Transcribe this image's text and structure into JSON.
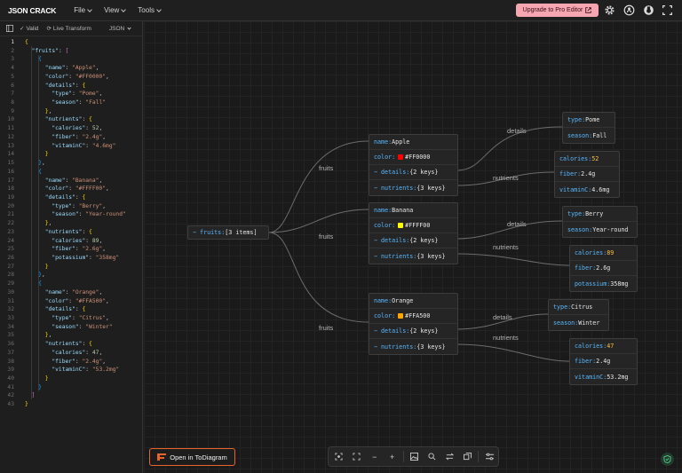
{
  "app": {
    "brand": "JSON CRACK",
    "menu": [
      "File",
      "View",
      "Tools"
    ],
    "upgrade_label": "Upgrade to Pro Editor",
    "icons": [
      "gear-icon",
      "github-icon",
      "discord-icon",
      "fullscreen-icon"
    ]
  },
  "editor": {
    "valid_label": "Valid",
    "transform_label": "Live Transform",
    "format_label": "JSON",
    "line_count": 43,
    "lines": [
      "{",
      "  \"fruits\": [",
      "    {",
      "      \"name\": \"Apple\",",
      "      \"color\": \"#FF0000\",",
      "      \"details\": {",
      "        \"type\": \"Pome\",",
      "        \"season\": \"Fall\"",
      "      },",
      "      \"nutrients\": {",
      "        \"calories\": 52,",
      "        \"fiber\": \"2.4g\",",
      "        \"vitaminC\": \"4.6mg\"",
      "      }",
      "    },",
      "    {",
      "      \"name\": \"Banana\",",
      "      \"color\": \"#FFFF00\",",
      "      \"details\": {",
      "        \"type\": \"Berry\",",
      "        \"season\": \"Year-round\"",
      "      },",
      "      \"nutrients\": {",
      "        \"calories\": 89,",
      "        \"fiber\": \"2.6g\",",
      "        \"potassium\": \"358mg\"",
      "      }",
      "    },",
      "    {",
      "      \"name\": \"Orange\",",
      "      \"color\": \"#FFA500\",",
      "      \"details\": {",
      "        \"type\": \"Citrus\",",
      "        \"season\": \"Winter\"",
      "      },",
      "      \"nutrients\": {",
      "        \"calories\": 47,",
      "        \"fiber\": \"2.4g\",",
      "        \"vitaminC\": \"53.2mg\"",
      "      }",
      "    }",
      "  ]",
      "}"
    ]
  },
  "graph": {
    "root": {
      "key": "fruits",
      "value": "[3 items]"
    },
    "edge_labels": {
      "fruits": "fruits",
      "details": "details",
      "nutrients": "nutrients"
    },
    "fruits": [
      {
        "name": "Apple",
        "color": "#FF0000",
        "details_summary": "{2 keys}",
        "nutrients_summary": "{3 keys}",
        "details": [
          {
            "k": "type",
            "v": "Pome"
          },
          {
            "k": "season",
            "v": "Fall"
          }
        ],
        "nutrients": [
          {
            "k": "calories",
            "v": "52",
            "num": true
          },
          {
            "k": "fiber",
            "v": "2.4g"
          },
          {
            "k": "vitaminC",
            "v": "4.6mg"
          }
        ]
      },
      {
        "name": "Banana",
        "color": "#FFFF00",
        "details_summary": "{2 keys}",
        "nutrients_summary": "{3 keys}",
        "details": [
          {
            "k": "type",
            "v": "Berry"
          },
          {
            "k": "season",
            "v": "Year-round"
          }
        ],
        "nutrients": [
          {
            "k": "calories",
            "v": "89",
            "num": true
          },
          {
            "k": "fiber",
            "v": "2.6g"
          },
          {
            "k": "potassium",
            "v": "358mg"
          }
        ]
      },
      {
        "name": "Orange",
        "color": "#FFA500",
        "details_summary": "{2 keys}",
        "nutrients_summary": "{3 keys}",
        "details": [
          {
            "k": "type",
            "v": "Citrus"
          },
          {
            "k": "season",
            "v": "Winter"
          }
        ],
        "nutrients": [
          {
            "k": "calories",
            "v": "47",
            "num": true
          },
          {
            "k": "fiber",
            "v": "2.4g"
          },
          {
            "k": "vitaminC",
            "v": "53.2mg"
          }
        ]
      }
    ]
  },
  "labels": {
    "name": "name",
    "color": "color",
    "details": "details",
    "nutrients": "nutrients"
  },
  "footer": {
    "todiagram_label": "Open in ToDiagram",
    "toolbar_icons": [
      "focus-icon",
      "fit-screen-icon",
      "zoom-out-icon",
      "zoom-in-icon",
      "image-export-icon",
      "search-icon",
      "swap-direction-icon",
      "collapse-icon",
      "settings-icon"
    ]
  }
}
